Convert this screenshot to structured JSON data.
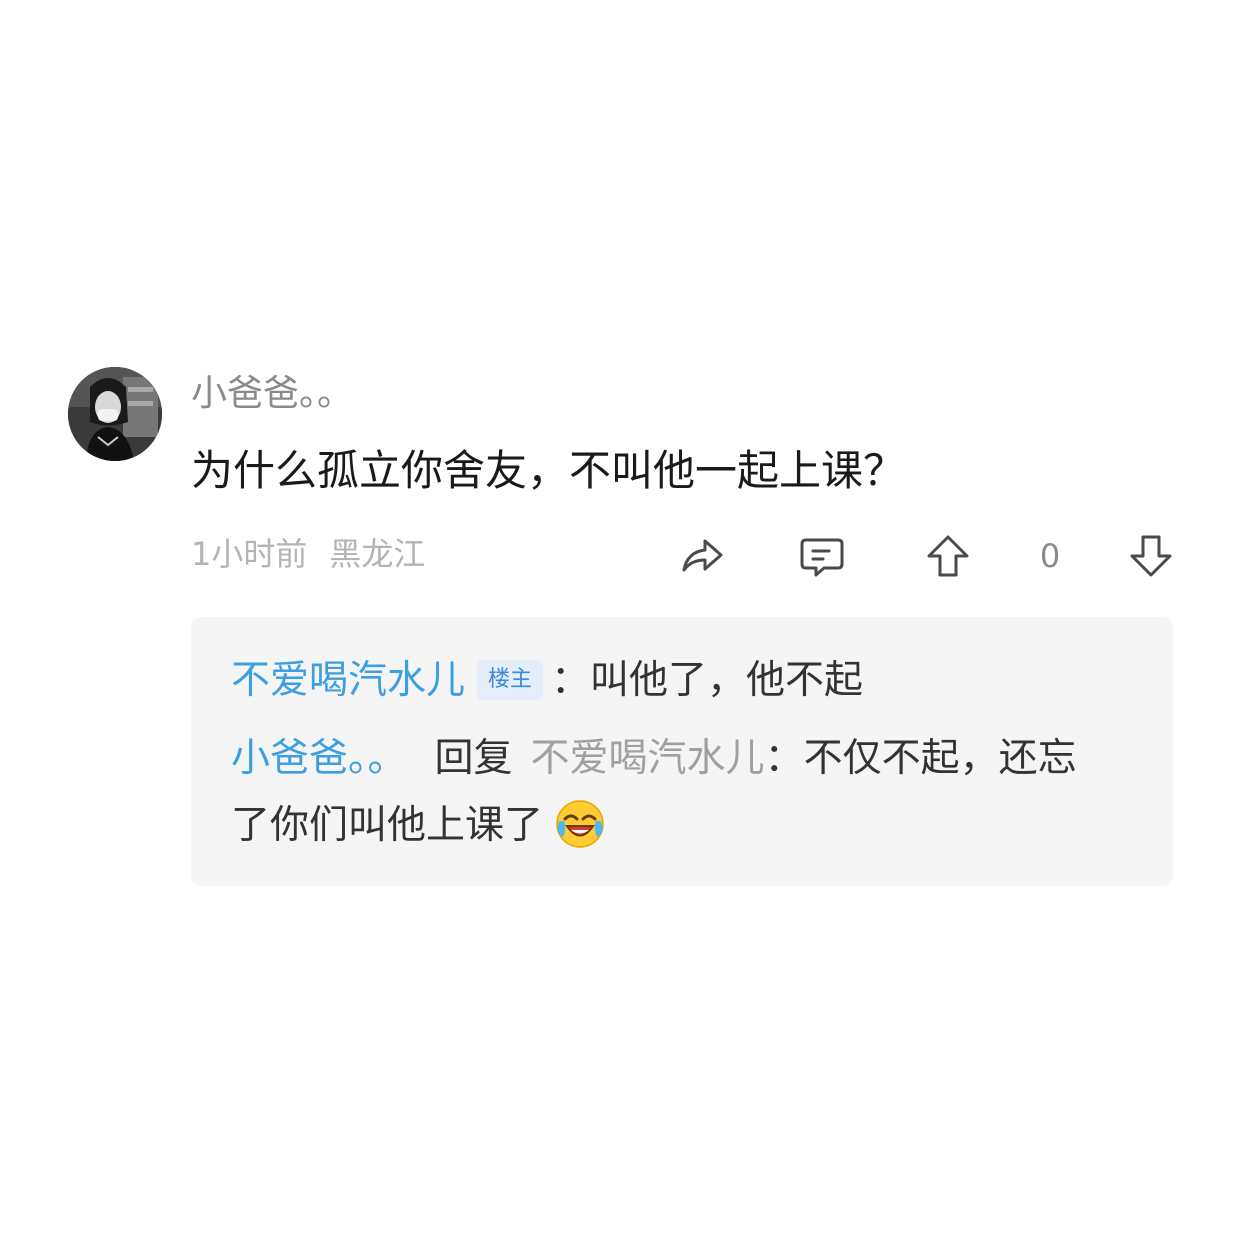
{
  "comment": {
    "username": "小爸爸。。",
    "text": "为什么孤立你舍友，不叫他一起上课？",
    "time": "1小时前",
    "location": "黑龙江",
    "vote_count": "0",
    "icons": {
      "avatar": "avatar-image",
      "share": "share-icon",
      "reply": "comment-bubble-icon",
      "upvote": "arrow-up-icon",
      "downvote": "arrow-down-icon"
    }
  },
  "replies": [
    {
      "author": "不爱喝汽水儿",
      "badge": "楼主",
      "separator": "：",
      "text": "叫他了，他不起"
    },
    {
      "author": "小爸爸。。",
      "reply_word": "回复",
      "reply_to": "不爱喝汽水儿",
      "separator": "：",
      "text_line1": "不仅不起，还忘",
      "text_line2": "了你们叫他上课了",
      "emoji": "laughing-tears-emoji"
    }
  ],
  "colors": {
    "link_blue": "#3d9fe0",
    "badge_bg": "#e3eefa",
    "reply_bg": "#f5f5f5",
    "meta_gray": "#b4b4b4"
  }
}
